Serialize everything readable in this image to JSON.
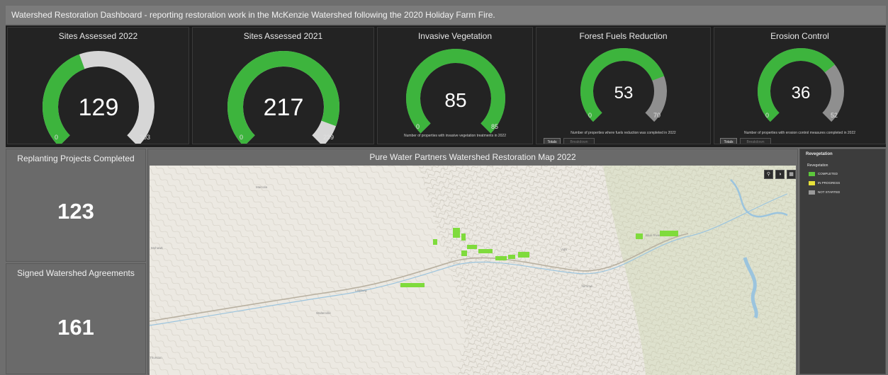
{
  "banner": {
    "text": "Watershed Restoration Dashboard - reporting restoration work in the McKenzie Watershed following the 2020 Holiday Farm Fire."
  },
  "colors": {
    "accent_green": "#3db43d",
    "remaining_light": "#d6d6d6",
    "remaining_dark": "#8f8f8f"
  },
  "gauges": [
    {
      "title": "Sites Assessed 2022",
      "value": "129",
      "min": "0",
      "max": "303",
      "fraction": 0.4257,
      "remaining": "light",
      "note": "",
      "buttons": []
    },
    {
      "title": "Sites Assessed 2021",
      "value": "217",
      "min": "0",
      "max": "239",
      "fraction": 0.908,
      "remaining": "light",
      "note": "",
      "buttons": []
    },
    {
      "title": "Invasive Vegetation",
      "value": "85",
      "min": "0",
      "max": "85",
      "fraction": 1.0,
      "remaining": "dark",
      "note": "Number of properties with invasive vegetation treatments in 2022",
      "buttons": []
    },
    {
      "title": "Forest Fuels Reduction",
      "value": "53",
      "min": "0",
      "max": "70",
      "fraction": 0.757,
      "remaining": "dark",
      "note": "Number of properties where fuels reduction was completed in 2022",
      "buttons": [
        "Totals",
        "Breakdown"
      ]
    },
    {
      "title": "Erosion Control",
      "value": "36",
      "min": "0",
      "max": "52",
      "fraction": 0.692,
      "remaining": "dark",
      "note": "Number of properties with erosion control measures completed in 2022",
      "buttons": [
        "Totals",
        "Breakdown"
      ]
    }
  ],
  "stats": [
    {
      "title": "Replanting Projects Completed",
      "value": "123"
    },
    {
      "title": "Signed Watershed Agreements",
      "value": "161"
    }
  ],
  "map": {
    "title": "Pure Water Partners Watershed Restoration Map 2022",
    "tools": [
      "search-icon",
      "basemap-icon",
      "layers-icon"
    ]
  },
  "legend": {
    "heading": "Revegetation",
    "subheading": "Revegetation",
    "items": [
      {
        "label": "COMPLETED",
        "color": "#5cc83c"
      },
      {
        "label": "IN PROGRESS",
        "color": "#e8e23a"
      },
      {
        "label": "NOT STARTED",
        "color": "#9a9a9a"
      }
    ]
  }
}
